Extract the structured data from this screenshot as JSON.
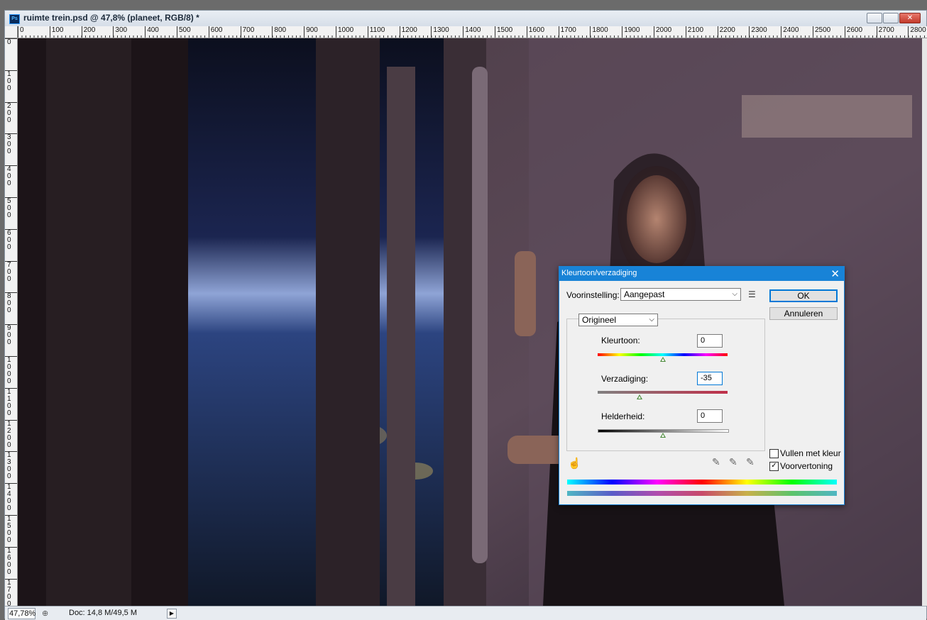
{
  "document": {
    "title": "ruimte trein.psd @ 47,8% (planeet, RGB/8) *",
    "app_badge": "Ps",
    "window_buttons": {
      "minimize_icon": "minimize-icon",
      "maximize_icon": "maximize-icon",
      "close_icon": "close-icon",
      "close_glyph": "✕"
    }
  },
  "rulers": {
    "horizontal": [
      "0",
      "100",
      "200",
      "300",
      "400",
      "500",
      "600",
      "700",
      "800",
      "900",
      "1000",
      "1100",
      "1200",
      "1300",
      "1400",
      "1500",
      "1600",
      "1700",
      "1800",
      "1900",
      "2000",
      "2100",
      "2200",
      "2300",
      "2400",
      "2500",
      "2600",
      "2700",
      "2800"
    ],
    "vertical": [
      "0",
      "100",
      "200",
      "300",
      "400",
      "500",
      "600",
      "700",
      "800",
      "900",
      "1000",
      "1100",
      "1200",
      "1300",
      "1400",
      "1500",
      "1600",
      "1700"
    ]
  },
  "status_bar": {
    "zoom": "47,78%",
    "doc_size": "Doc: 14,8 M/49,5 M",
    "arrow": "▶"
  },
  "dialog": {
    "title": "Kleurtoon/verzadiging",
    "close_glyph": "✕",
    "preset_label": "Voorinstelling:",
    "preset_value": "Aangepast",
    "ok_label": "OK",
    "cancel_label": "Annuleren",
    "channel_value": "Origineel",
    "hue_label": "Kleurtoon:",
    "hue_value": "0",
    "saturation_label": "Verzadiging:",
    "saturation_value": "-35",
    "lightness_label": "Helderheid:",
    "lightness_value": "0",
    "colorize_label": "Vullen met kleur",
    "colorize_checked": false,
    "preview_label": "Voorvertoning",
    "preview_checked": true,
    "hue_level": 0,
    "saturation_level": -35,
    "lightness_level": 0
  },
  "colors": {
    "accent": "#1883d7",
    "dialog_bg": "#f0f0f0"
  }
}
